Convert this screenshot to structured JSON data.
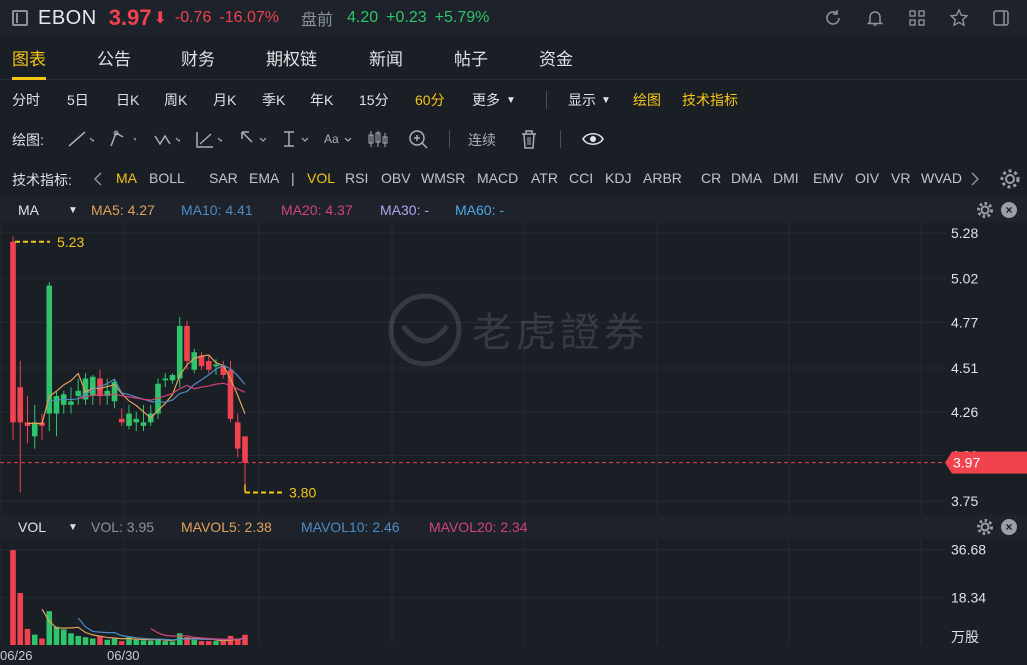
{
  "header": {
    "symbol": "EBON",
    "price": "3.97",
    "arrow": "⬇",
    "change": "-0.76",
    "change_pct": "-16.07%",
    "premarket_label": "盘前",
    "premarket_price": "4.20",
    "premarket_change": "+0.23",
    "premarket_pct": "+5.79%"
  },
  "tabs": [
    "图表",
    "公告",
    "财务",
    "期权链",
    "新闻",
    "帖子",
    "资金"
  ],
  "periods": [
    "分时",
    "5日",
    "日K",
    "周K",
    "月K",
    "季K",
    "年K",
    "15分",
    "60分",
    "更多"
  ],
  "period_selected": "60分",
  "display_label": "显示",
  "draw_label": "绘图",
  "tech_label": "技术指标",
  "draw_row": {
    "label": "绘图:",
    "continuous": "连续",
    "text_tool": "Aa"
  },
  "indicator_row": {
    "label": "技术指标:",
    "items": [
      "MA",
      "BOLL",
      "SAR",
      "EMA",
      "|",
      "VOL",
      "RSI",
      "OBV",
      "WMSR",
      "MACD",
      "ATR",
      "CCI",
      "KDJ",
      "ARBR",
      "CR",
      "DMA",
      "DMI",
      "EMV",
      "OIV",
      "VR",
      "WVAD"
    ],
    "active": [
      "MA",
      "VOL"
    ]
  },
  "ma_legend": {
    "name": "MA",
    "items": [
      {
        "label": "MA5: 4.27",
        "color": "#e0a15a"
      },
      {
        "label": "MA10: 4.41",
        "color": "#4c8bc4"
      },
      {
        "label": "MA20: 4.37",
        "color": "#d2447a"
      },
      {
        "label": "MA30: -",
        "color": "#a9a6f0"
      },
      {
        "label": "MA60: -",
        "color": "#4ea8e8"
      }
    ]
  },
  "vol_legend": {
    "name": "VOL",
    "items": [
      {
        "label": "VOL: 3.95",
        "color": "#8b929c"
      },
      {
        "label": "MAVOL5: 2.38",
        "color": "#e0a15a"
      },
      {
        "label": "MAVOL10: 2.46",
        "color": "#4c8bc4"
      },
      {
        "label": "MAVOL20: 2.34",
        "color": "#d2447a"
      }
    ]
  },
  "price_axis": [
    "5.28",
    "5.02",
    "4.77",
    "4.51",
    "4.26",
    "4.01",
    "3.75"
  ],
  "current_price_tag": "3.97",
  "high_label": "5.23",
  "low_label": "3.80",
  "vol_axis": [
    "36.68",
    "18.34",
    "万股"
  ],
  "x_labels": [
    "06/26",
    "06/30"
  ],
  "watermark": "老虎證券",
  "colors": {
    "up": "#2ec46a",
    "down": "#f0424f",
    "accent": "#f5c518"
  },
  "chart_data": {
    "type": "candlestick",
    "ylim": [
      3.7,
      5.32
    ],
    "candles": [
      {
        "o": 5.23,
        "h": 5.26,
        "l": 4.1,
        "c": 4.2,
        "v": 36.5
      },
      {
        "o": 4.4,
        "h": 4.55,
        "l": 3.8,
        "c": 4.2,
        "v": 20.0
      },
      {
        "o": 4.2,
        "h": 4.35,
        "l": 4.08,
        "c": 4.18,
        "v": 6.2
      },
      {
        "o": 4.12,
        "h": 4.3,
        "l": 4.05,
        "c": 4.2,
        "v": 4.0
      },
      {
        "o": 4.2,
        "h": 4.25,
        "l": 4.1,
        "c": 4.18,
        "v": 2.5
      },
      {
        "o": 4.25,
        "h": 5.0,
        "l": 4.15,
        "c": 4.98,
        "v": 13.0
      },
      {
        "o": 4.25,
        "h": 4.38,
        "l": 4.12,
        "c": 4.35,
        "v": 7.0
      },
      {
        "o": 4.3,
        "h": 4.38,
        "l": 4.25,
        "c": 4.36,
        "v": 6.0
      },
      {
        "o": 4.3,
        "h": 4.4,
        "l": 4.25,
        "c": 4.32,
        "v": 4.5
      },
      {
        "o": 4.35,
        "h": 4.45,
        "l": 4.3,
        "c": 4.38,
        "v": 3.5
      },
      {
        "o": 4.33,
        "h": 4.48,
        "l": 4.3,
        "c": 4.45,
        "v": 3.0
      },
      {
        "o": 4.35,
        "h": 4.47,
        "l": 4.3,
        "c": 4.46,
        "v": 2.5
      },
      {
        "o": 4.45,
        "h": 4.5,
        "l": 4.3,
        "c": 4.35,
        "v": 3.5
      },
      {
        "o": 4.35,
        "h": 4.45,
        "l": 4.3,
        "c": 4.38,
        "v": 2.0
      },
      {
        "o": 4.32,
        "h": 4.45,
        "l": 4.28,
        "c": 4.43,
        "v": 2.5
      },
      {
        "o": 4.22,
        "h": 4.28,
        "l": 4.18,
        "c": 4.2,
        "v": 1.5
      },
      {
        "o": 4.18,
        "h": 4.3,
        "l": 4.16,
        "c": 4.25,
        "v": 3.0
      },
      {
        "o": 4.2,
        "h": 4.26,
        "l": 4.15,
        "c": 4.22,
        "v": 2.0
      },
      {
        "o": 4.18,
        "h": 4.3,
        "l": 4.15,
        "c": 4.2,
        "v": 1.8
      },
      {
        "o": 4.2,
        "h": 4.3,
        "l": 4.18,
        "c": 4.25,
        "v": 1.6
      },
      {
        "o": 4.25,
        "h": 4.45,
        "l": 4.22,
        "c": 4.42,
        "v": 2.5
      },
      {
        "o": 4.44,
        "h": 4.48,
        "l": 4.4,
        "c": 4.45,
        "v": 1.5
      },
      {
        "o": 4.44,
        "h": 4.48,
        "l": 4.42,
        "c": 4.47,
        "v": 1.4
      },
      {
        "o": 4.45,
        "h": 4.8,
        "l": 4.4,
        "c": 4.75,
        "v": 4.5
      },
      {
        "o": 4.75,
        "h": 4.78,
        "l": 4.5,
        "c": 4.55,
        "v": 3.0
      },
      {
        "o": 4.5,
        "h": 4.62,
        "l": 4.48,
        "c": 4.6,
        "v": 2.0
      },
      {
        "o": 4.58,
        "h": 4.6,
        "l": 4.5,
        "c": 4.52,
        "v": 1.5
      },
      {
        "o": 4.55,
        "h": 4.58,
        "l": 4.48,
        "c": 4.5,
        "v": 1.5
      },
      {
        "o": 4.52,
        "h": 4.56,
        "l": 4.47,
        "c": 4.53,
        "v": 1.5
      },
      {
        "o": 4.52,
        "h": 4.55,
        "l": 4.45,
        "c": 4.47,
        "v": 1.5
      },
      {
        "o": 4.5,
        "h": 4.55,
        "l": 4.2,
        "c": 4.22,
        "v": 3.5
      },
      {
        "o": 4.2,
        "h": 4.25,
        "l": 4.0,
        "c": 4.05,
        "v": 2.5
      },
      {
        "o": 4.12,
        "h": 4.12,
        "l": 3.8,
        "c": 3.97,
        "v": 3.95
      }
    ]
  }
}
